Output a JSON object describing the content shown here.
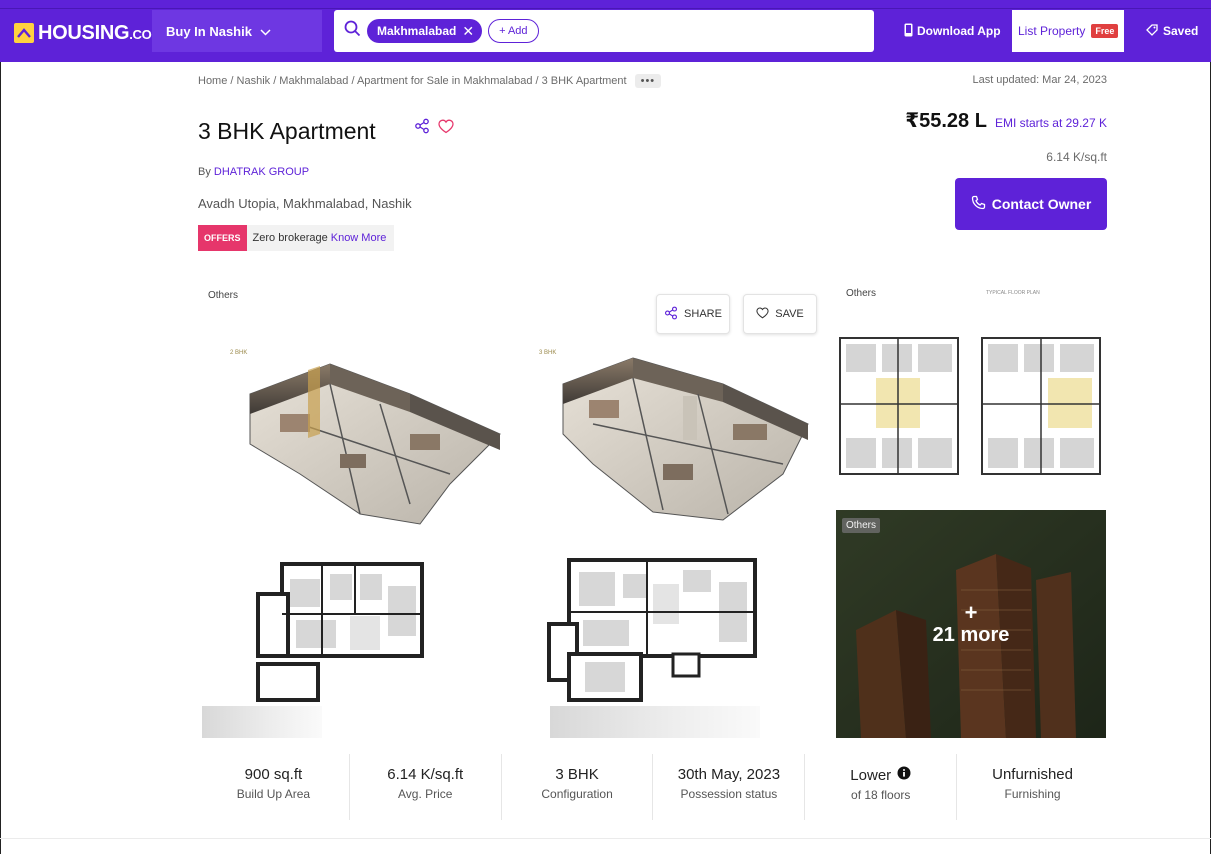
{
  "header": {
    "logo_main": "HOUSING",
    "logo_suffix": ".COM",
    "city_label": "Buy In Nashik",
    "search_chip": "Makhmalabad",
    "add_label": "+ Add",
    "download_label": "Download App",
    "list_property_label": "List Property",
    "free_badge": "Free",
    "saved_label": "Saved"
  },
  "breadcrumb": {
    "path": "Home / Nashik / Makhmalabad / Apartment for Sale in Makhmalabad / 3 BHK Apartment",
    "more": "•••"
  },
  "listing": {
    "last_updated": "Last updated: Mar 24, 2023",
    "title": "3 BHK Apartment",
    "by_prefix": "By",
    "builder": "DHATRAK GROUP",
    "address": "Avadh Utopia, Makhmalabad, Nashik",
    "offers_tag": "OFFERS",
    "offer_text": "Zero brokerage",
    "know_more": "Know More",
    "price": "₹55.28 L",
    "emi": "EMI starts at  29.27 K",
    "price_per_sqft": "6.14 K/sq.ft",
    "contact_label": "Contact Owner"
  },
  "gallery": {
    "label_left": "Others",
    "label_right": "Others",
    "label_overlay": "Others",
    "share_label": "SHARE",
    "save_label": "SAVE",
    "bhk_tag_1": "2 BHK",
    "bhk_tag_2": "3 BHK",
    "floor_plan_caption": "TYPICAL FLOOR PLAN",
    "more_plus": "+",
    "more_text": "21 more"
  },
  "stats": [
    {
      "value": "900 sq.ft",
      "label": "Build Up Area"
    },
    {
      "value": "6.14 K/sq.ft",
      "label": "Avg. Price"
    },
    {
      "value": "3 BHK",
      "label": "Configuration"
    },
    {
      "value": "30th May, 2023",
      "label": "Possession status"
    },
    {
      "value": "Lower",
      "label": "of 18 floors"
    },
    {
      "value": "Unfurnished",
      "label": "Furnishing"
    }
  ],
  "colors": {
    "brand": "#5e22d8",
    "offer_tag": "#e6366b",
    "free_badge": "#e03f3f",
    "logo_mark": "#ffd23f"
  }
}
